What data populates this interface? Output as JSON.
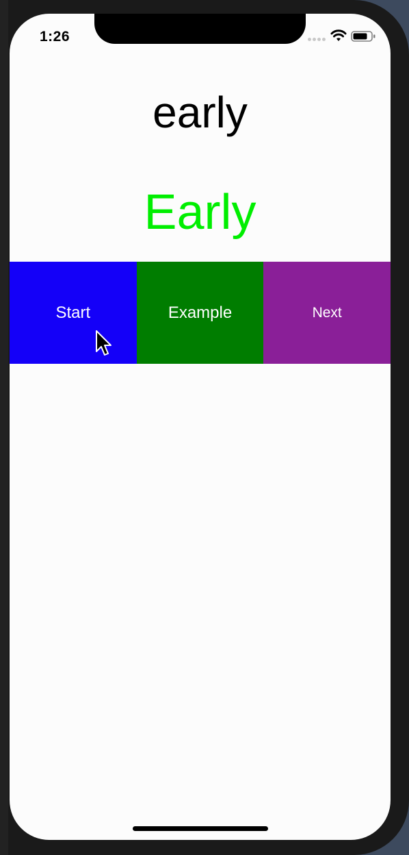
{
  "status_bar": {
    "time": "1:26"
  },
  "content": {
    "word_lower": "early",
    "word_upper": "Early"
  },
  "buttons": {
    "start": "Start",
    "example": "Example",
    "next": "Next"
  },
  "colors": {
    "upper_word": "#00ee00",
    "start_button": "#1400f8",
    "example_button": "#007d00",
    "next_button": "#8a1f98"
  }
}
